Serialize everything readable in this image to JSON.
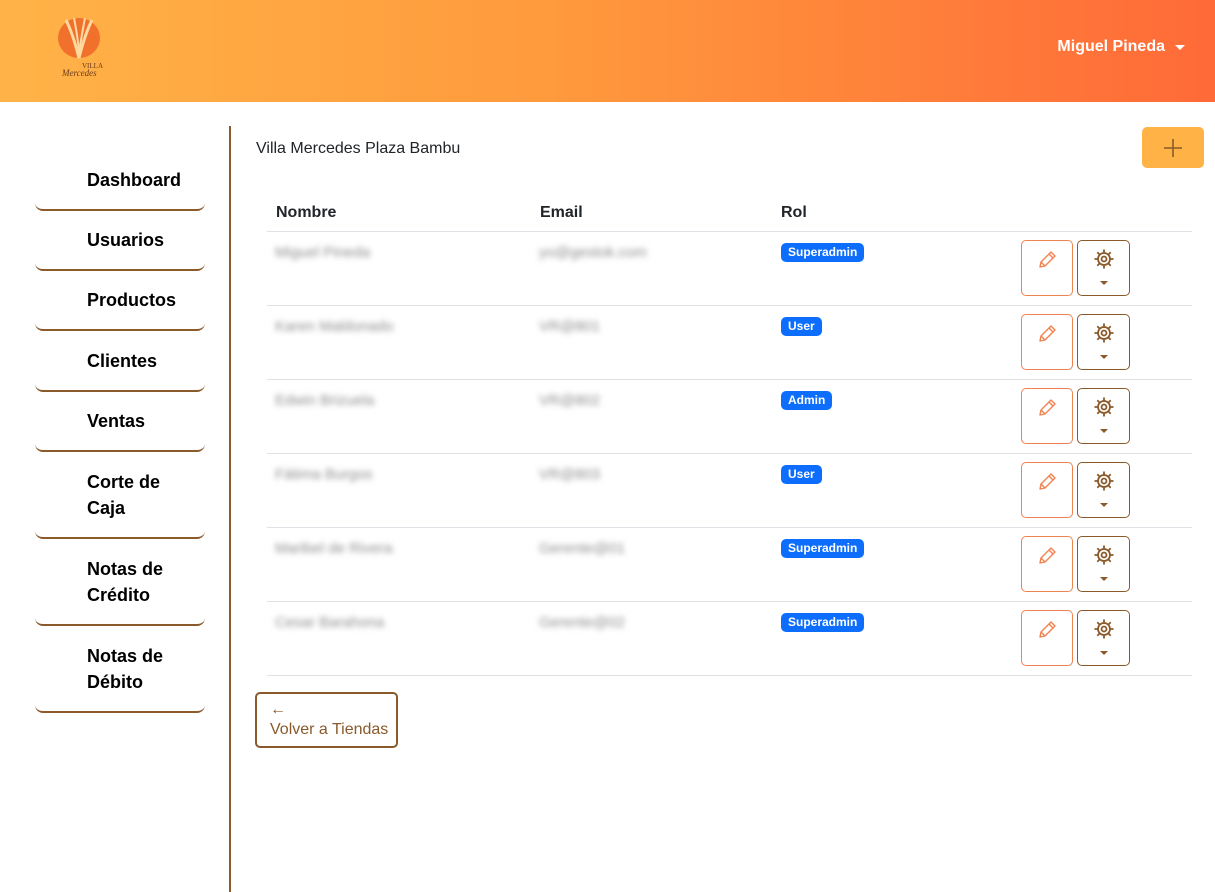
{
  "header": {
    "logo_text": "Villa Mercedes",
    "user_name": "Miguel Pineda"
  },
  "sidebar": {
    "items": [
      {
        "label": "Dashboard"
      },
      {
        "label": "Usuarios"
      },
      {
        "label": "Productos"
      },
      {
        "label": "Clientes"
      },
      {
        "label": "Ventas"
      },
      {
        "label": "Corte de Caja"
      },
      {
        "label": "Notas de Crédito"
      },
      {
        "label": "Notas de Débito"
      }
    ]
  },
  "main": {
    "store_title": "Villa Mercedes Plaza Bambu",
    "add_button_icon": "plus-icon",
    "table": {
      "headers": [
        "Nombre",
        "Email",
        "Rol"
      ],
      "rows": [
        {
          "name": "Miguel Pineda",
          "email": "yo@gestok.com",
          "role": "Superadmin"
        },
        {
          "name": "Karen Maldonado",
          "email": "VR@801",
          "role": "User"
        },
        {
          "name": "Edwin Brizuela",
          "email": "VR@802",
          "role": "Admin"
        },
        {
          "name": "Fátima Burgos",
          "email": "VR@803",
          "role": "User"
        },
        {
          "name": "Maribel de Rivera",
          "email": "Gerente@01",
          "role": "Superadmin"
        },
        {
          "name": "Cesar Barahona",
          "email": "Gerente@02",
          "role": "Superadmin"
        }
      ]
    },
    "back_button": {
      "arrow": "←",
      "label": "Volver a Tiendas"
    }
  },
  "colors": {
    "header_gradient_start": "#ffb347",
    "header_gradient_end": "#ff6a38",
    "accent_brown": "#8a5a2b",
    "edit_orange": "#f08250",
    "badge_blue": "#0d6efd",
    "add_button": "#ffb347"
  }
}
